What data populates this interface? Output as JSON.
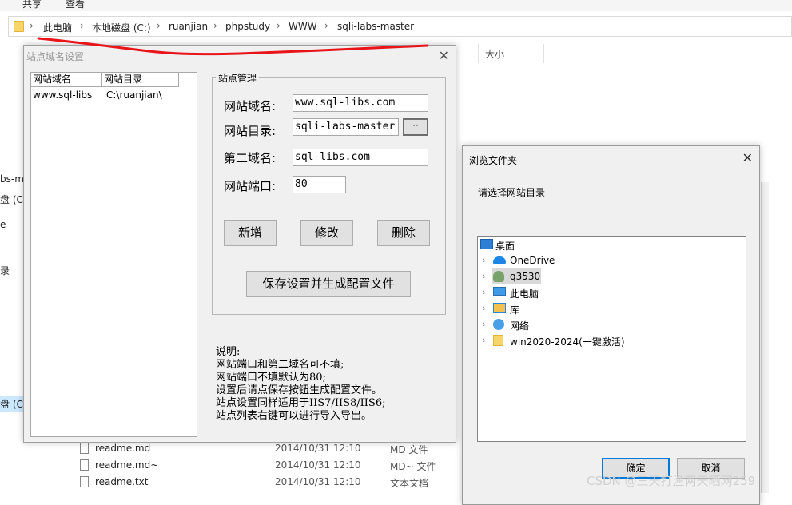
{
  "ribbon": {
    "tabs": [
      "共享",
      "查看"
    ]
  },
  "address_bar": {
    "crumbs": [
      "此电脑",
      "本地磁盘 (C:)",
      "ruanjian",
      "phpstudy",
      "WWW",
      "sqli-labs-master"
    ]
  },
  "explorer": {
    "column_size": "大小",
    "sidebar_fragments": [
      "bs-ma",
      "盘 (C:)",
      "e",
      "录",
      "盘 (C:)"
    ],
    "files": [
      {
        "name": "readme.md",
        "date": "2014/10/31 12:10",
        "type": "MD 文件"
      },
      {
        "name": "readme.md~",
        "date": "2014/10/31 12:10",
        "type": "MD~ 文件"
      },
      {
        "name": "readme.txt",
        "date": "2014/10/31 12:10",
        "type": "文本文档"
      }
    ]
  },
  "site_dialog": {
    "title": "站点域名设置",
    "list_headers": [
      "网站域名",
      "网站目录"
    ],
    "list_rows": [
      {
        "domain": "www.sql-libs",
        "dir": "C:\\ruanjian\\"
      }
    ],
    "group_title": "站点管理",
    "fields": {
      "domain": {
        "label": "网站域名:",
        "value": "www.sql-libs.com"
      },
      "dir": {
        "label": "网站目录:",
        "value": "sqli-labs-master"
      },
      "second_domain": {
        "label": "第二域名:",
        "value": "sql-libs.com"
      },
      "port": {
        "label": "网站端口:",
        "value": "80"
      }
    },
    "browse_button": "··",
    "buttons": {
      "add": "新增",
      "modify": "修改",
      "delete": "删除",
      "save": "保存设置并生成配置文件"
    },
    "notes": [
      "说明:",
      "网站端口和第二域名可不填;",
      "网站端口不填默认为80;",
      "设置后请点保存按钮生成配置文件。",
      "站点设置同样适用于IIS7/IIS8/IIS6;",
      "站点列表右键可以进行导入导出。"
    ]
  },
  "browse_dialog": {
    "title": "浏览文件夹",
    "prompt": "请选择网站目录",
    "tree": [
      {
        "label": "桌面",
        "icon": "desktop-icon",
        "expandable": false
      },
      {
        "label": "OneDrive",
        "icon": "cloud-icon",
        "expandable": true
      },
      {
        "label": "q3530",
        "icon": "user-icon",
        "expandable": true
      },
      {
        "label": "此电脑",
        "icon": "computer-icon",
        "expandable": true
      },
      {
        "label": "库",
        "icon": "library-icon",
        "expandable": true
      },
      {
        "label": "网络",
        "icon": "network-icon",
        "expandable": true
      },
      {
        "label": "win2020-2024(一键激活)",
        "icon": "folder-icon",
        "expandable": true
      }
    ],
    "ok": "确定",
    "cancel": "取消"
  },
  "watermark": "CSDN @三天打渔两天晒网259",
  "colors": {
    "annotation_red": "#e8141a",
    "default_button_border": "#0078d7"
  }
}
